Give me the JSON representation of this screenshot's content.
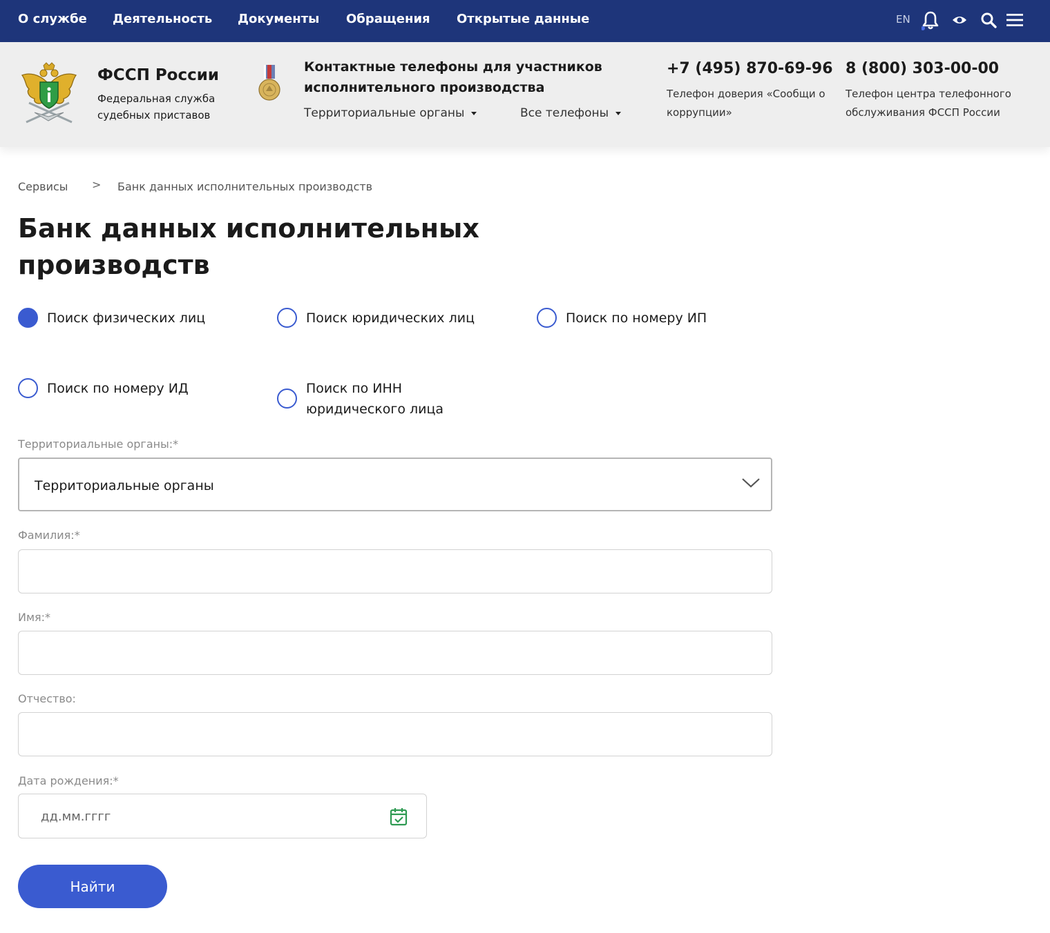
{
  "nav": {
    "items": [
      "О службе",
      "Деятельность",
      "Документы",
      "Обращения",
      "Открытые данные"
    ],
    "lang": "EN",
    "icons": [
      "bell-icon",
      "eye-icon",
      "search-icon",
      "menu-icon"
    ]
  },
  "header": {
    "org_title": "ФССП России",
    "org_subtitle": "Федеральная служба судебных приставов",
    "contacts_title": "Контактные телефоны для участников исполнительного производства",
    "dropdown_regions": "Территориальные органы",
    "dropdown_phones": "Все телефоны",
    "phone1": "+7 (495) 870-69-96",
    "phone1_desc": "Телефон доверия «Сообщи о коррупции»",
    "phone2": "8 (800) 303-00-00",
    "phone2_desc": "Телефон центра телефонного обслуживания ФССП России"
  },
  "breadcrumb": {
    "items": [
      "Сервисы",
      "Банк данных исполнительных производств"
    ],
    "separator": ">"
  },
  "page": {
    "title": "Банк данных исполнительных производств"
  },
  "search_types": {
    "options": [
      {
        "label": "Поиск физических лиц",
        "selected": true
      },
      {
        "label": "Поиск юридических лиц",
        "selected": false
      },
      {
        "label": "Поиск по номеру ИП",
        "selected": false
      },
      {
        "label": "Поиск по номеру ИД",
        "selected": false
      },
      {
        "label": "Поиск по ИНН юридического лица",
        "selected": false
      }
    ]
  },
  "form": {
    "region_label": "Территориальные органы:*",
    "region_value": "Территориальные органы",
    "lastname_label": "Фамилия:*",
    "lastname_value": "",
    "firstname_label": "Имя:*",
    "firstname_value": "",
    "patronymic_label": "Отчество:",
    "patronymic_value": "",
    "birthdate_label": "Дата рождения:*",
    "birthdate_placeholder": "дд.мм.гггг",
    "submit_label": "Найти"
  },
  "colors": {
    "nav_bg": "#1e357a",
    "header_bg": "#eeeeee",
    "accent": "#3a5bd0",
    "calendar_icon": "#2e9a52"
  }
}
